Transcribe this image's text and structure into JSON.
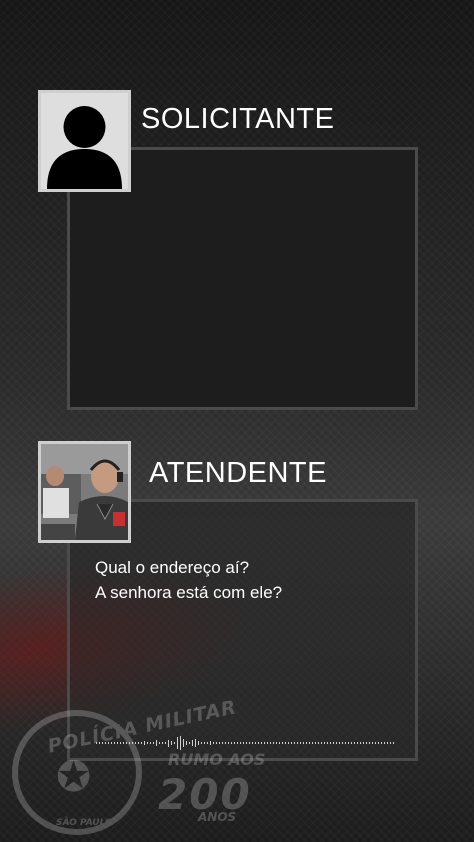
{
  "solicitante": {
    "title": "SOLICITANTE",
    "avatar_icon": "person-silhouette-icon"
  },
  "atendente": {
    "title": "ATENDENTE",
    "avatar_icon": "officer-photo",
    "transcript_lines": [
      "Qual o endereço aí?",
      "A senhora está com ele?"
    ]
  },
  "watermark": {
    "line1": "POLÍCIA MILITAR",
    "line2": "SÃO PAULO",
    "line3": "RUMO AOS",
    "line4": "200",
    "line5": "ANOS"
  },
  "colors": {
    "panel_border": "#4a4a4a",
    "text": "#ffffff",
    "accent_red": "#781414"
  }
}
